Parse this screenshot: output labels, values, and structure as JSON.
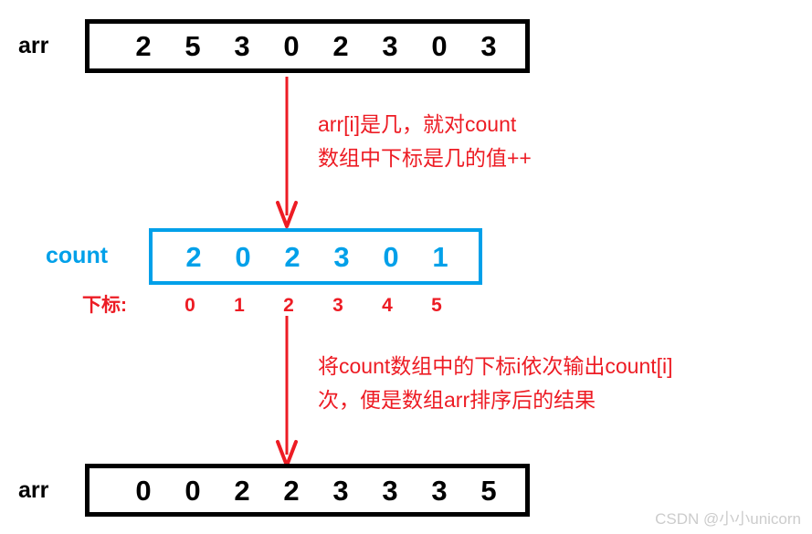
{
  "diagram": {
    "title": "Counting sort illustration",
    "colors": {
      "array_border": "#000000",
      "count_border": "#00a0e9",
      "count_text": "#00a0e9",
      "annotation_red": "#ed1c24",
      "index_red": "#ed1c24",
      "watermark": "#cccccc"
    }
  },
  "input_array": {
    "label": "arr",
    "values": [
      "2",
      "5",
      "3",
      "0",
      "2",
      "3",
      "0",
      "3"
    ]
  },
  "count_array": {
    "label": "count",
    "values": [
      "2",
      "0",
      "2",
      "3",
      "0",
      "1"
    ],
    "index_label": "下标:",
    "indices": [
      "0",
      "1",
      "2",
      "3",
      "4",
      "5"
    ]
  },
  "output_array": {
    "label": "arr",
    "values": [
      "0",
      "0",
      "2",
      "2",
      "3",
      "3",
      "3",
      "5"
    ]
  },
  "annotations": {
    "step1": {
      "line1": "arr[i]是几，就对count",
      "line2": "数组中下标是几的值++"
    },
    "step2": {
      "line1": "将count数组中的下标i依次输出count[i]",
      "line2": "次，便是数组arr排序后的结果"
    }
  },
  "watermark": {
    "text": "CSDN @小小unicorn"
  }
}
